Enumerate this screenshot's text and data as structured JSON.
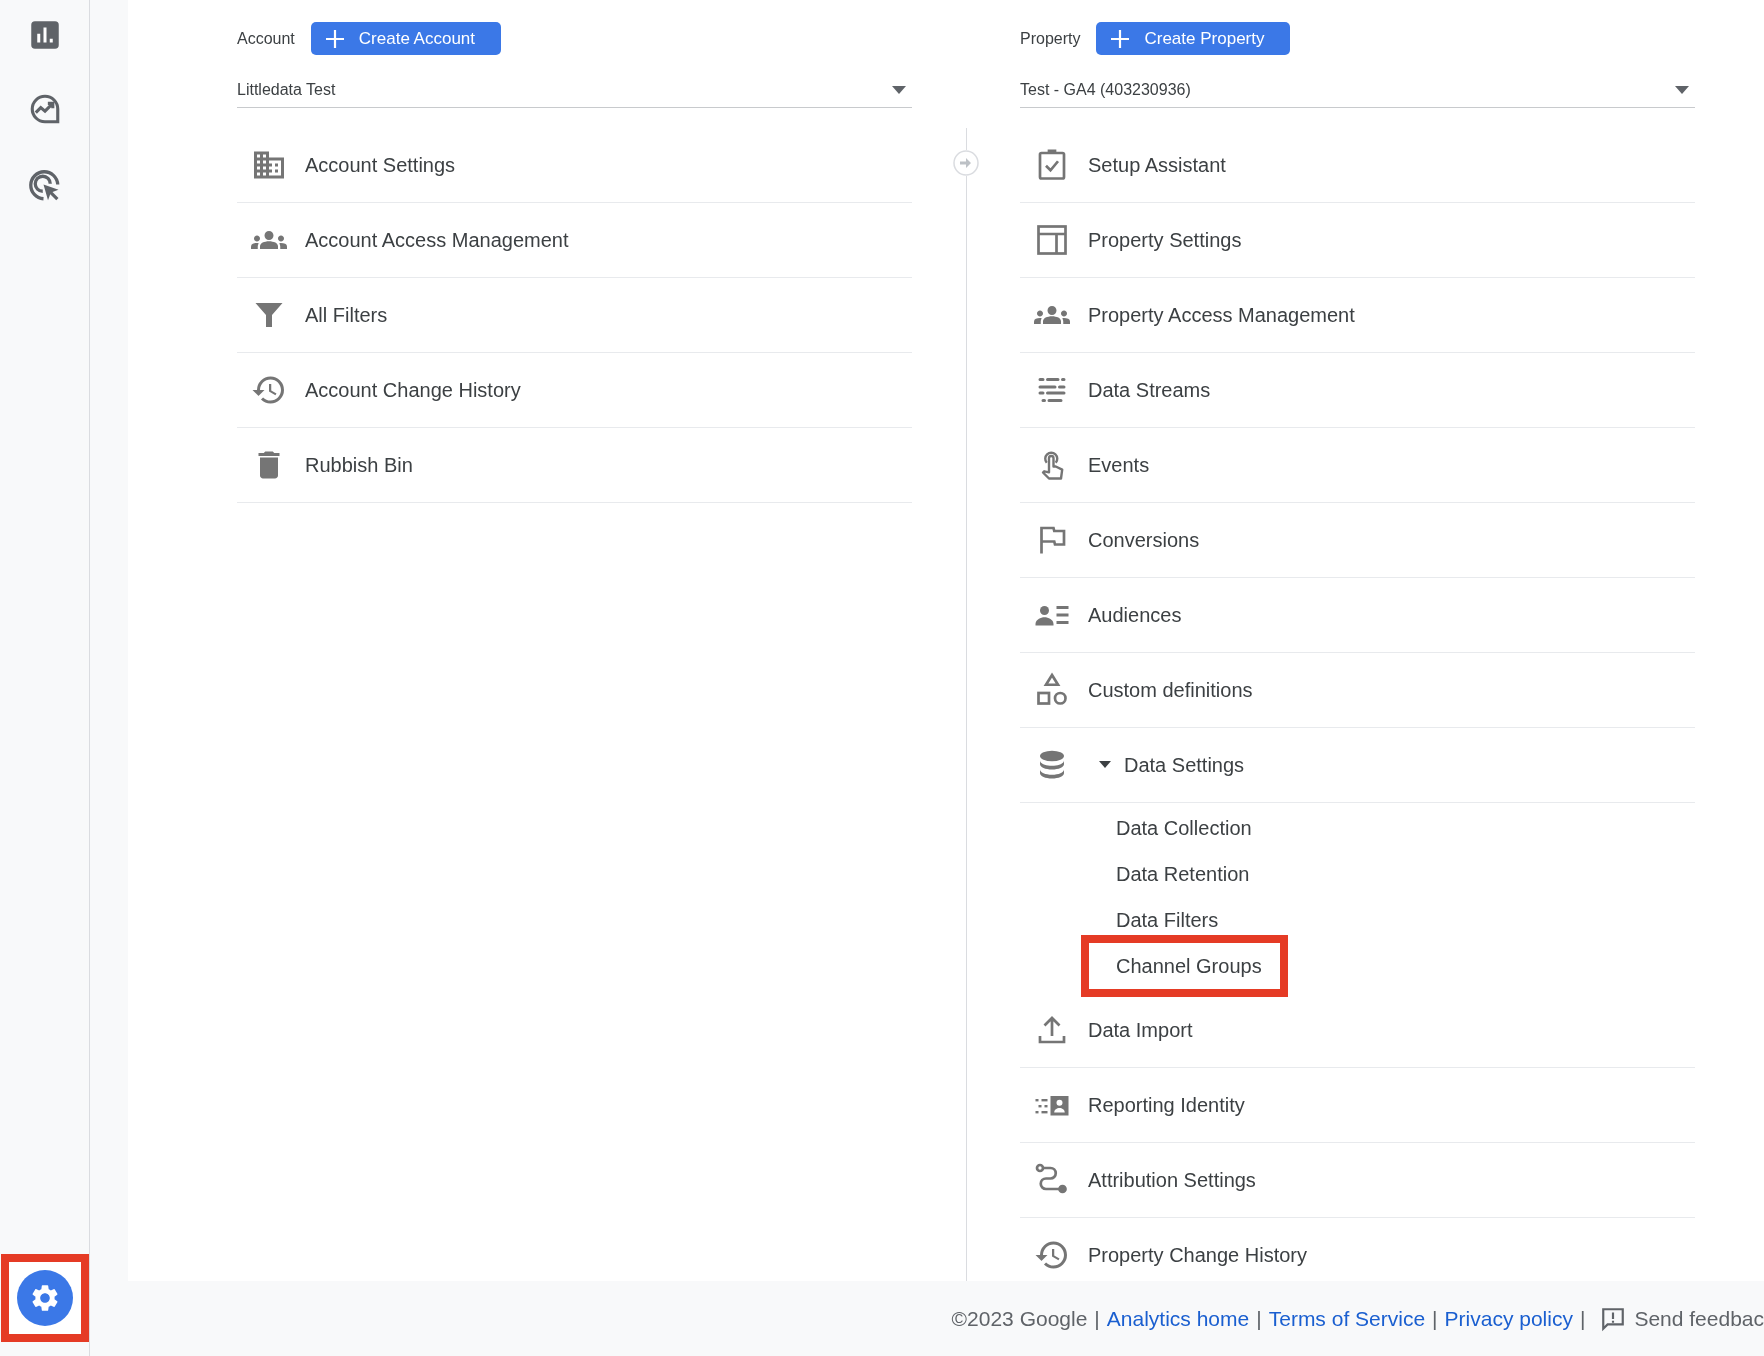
{
  "settings_button": {
    "highlighted": true
  },
  "account": {
    "label": "Account",
    "create_button": "Create Account",
    "selector": "Littledata Test",
    "items": [
      {
        "label": "Account Settings"
      },
      {
        "label": "Account Access Management"
      },
      {
        "label": "All Filters"
      },
      {
        "label": "Account Change History"
      },
      {
        "label": "Rubbish Bin"
      }
    ]
  },
  "property": {
    "label": "Property",
    "create_button": "Create Property",
    "selector": "Test - GA4 (403230936)",
    "items": [
      {
        "label": "Setup Assistant"
      },
      {
        "label": "Property Settings"
      },
      {
        "label": "Property Access Management"
      },
      {
        "label": "Data Streams"
      },
      {
        "label": "Events"
      },
      {
        "label": "Conversions"
      },
      {
        "label": "Audiences"
      },
      {
        "label": "Custom definitions"
      },
      {
        "label": "Data Settings",
        "expanded": true,
        "children": [
          {
            "label": "Data Collection",
            "highlighted": false
          },
          {
            "label": "Data Retention",
            "highlighted": false
          },
          {
            "label": "Data Filters",
            "highlighted": false
          },
          {
            "label": "Channel Groups",
            "highlighted": true
          }
        ]
      },
      {
        "label": "Data Import"
      },
      {
        "label": "Reporting Identity"
      },
      {
        "label": "Attribution Settings"
      },
      {
        "label": "Property Change History"
      }
    ]
  },
  "footer": [
    {
      "kind": "text",
      "text": "©2023 Google"
    },
    {
      "kind": "separator",
      "text": "|"
    },
    {
      "kind": "link",
      "text": "Analytics home"
    },
    {
      "kind": "separator",
      "text": "|"
    },
    {
      "kind": "link",
      "text": "Terms of Service"
    },
    {
      "kind": "separator",
      "text": "|"
    },
    {
      "kind": "link",
      "text": "Privacy policy"
    },
    {
      "kind": "separator",
      "text": "|"
    },
    {
      "kind": "feedback",
      "text": "Send feedbac"
    }
  ]
}
